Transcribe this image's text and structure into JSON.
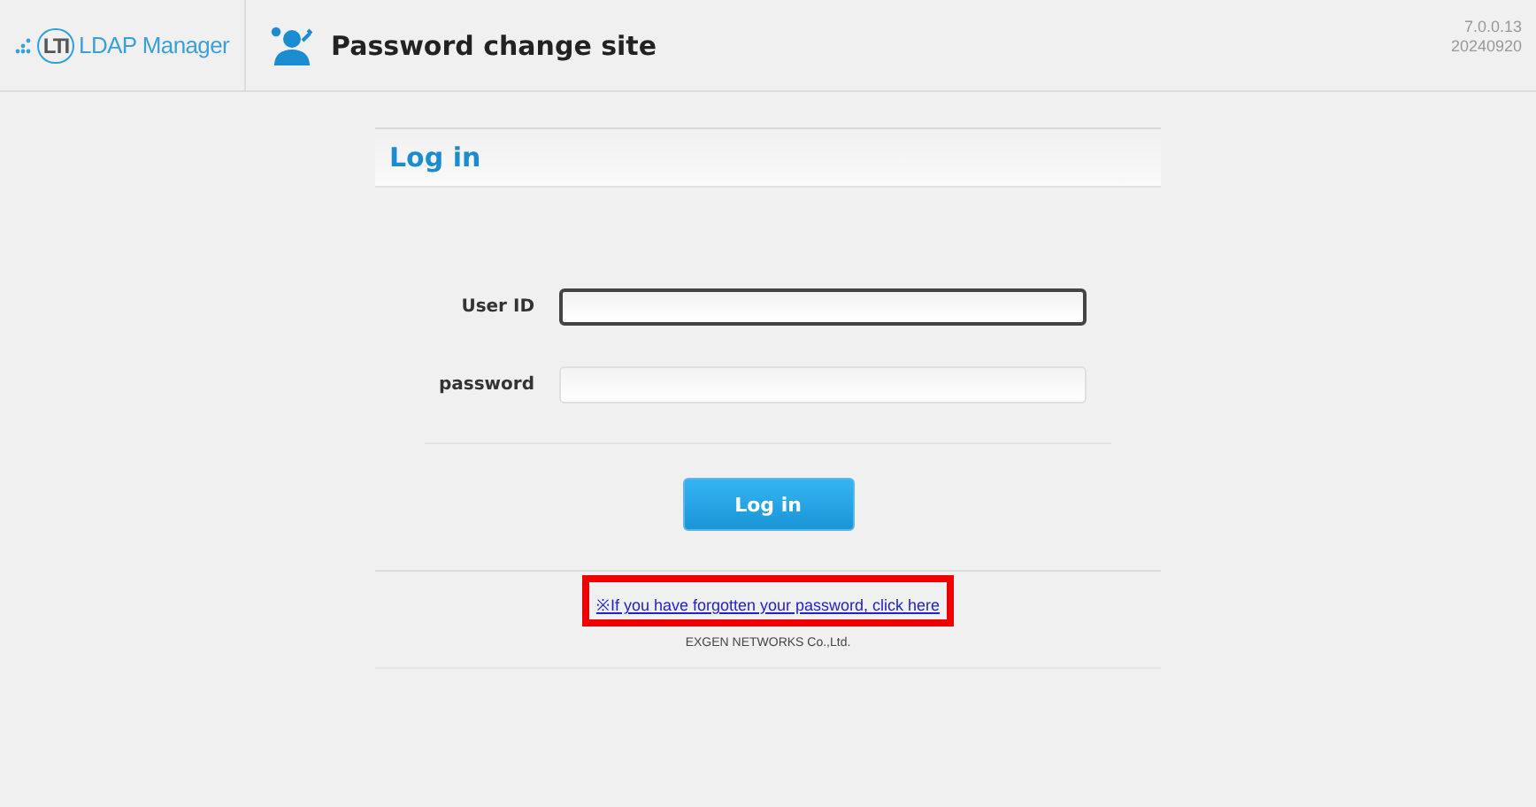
{
  "header": {
    "logo_mark": "LTI",
    "logo_text": "LDAP Manager",
    "site_title": "Password change site",
    "version": "7.0.0.13",
    "build": "20240920"
  },
  "login": {
    "title": "Log in",
    "fields": [
      {
        "label": "User ID",
        "focused": true
      },
      {
        "label": "password",
        "focused": false
      }
    ],
    "submit": "Log in",
    "forgot_link": {
      "text": "※If you have forgotten your password, click here",
      "highlighted": true
    },
    "footer": "EXGEN NETWORKS Co.,Ltd."
  }
}
